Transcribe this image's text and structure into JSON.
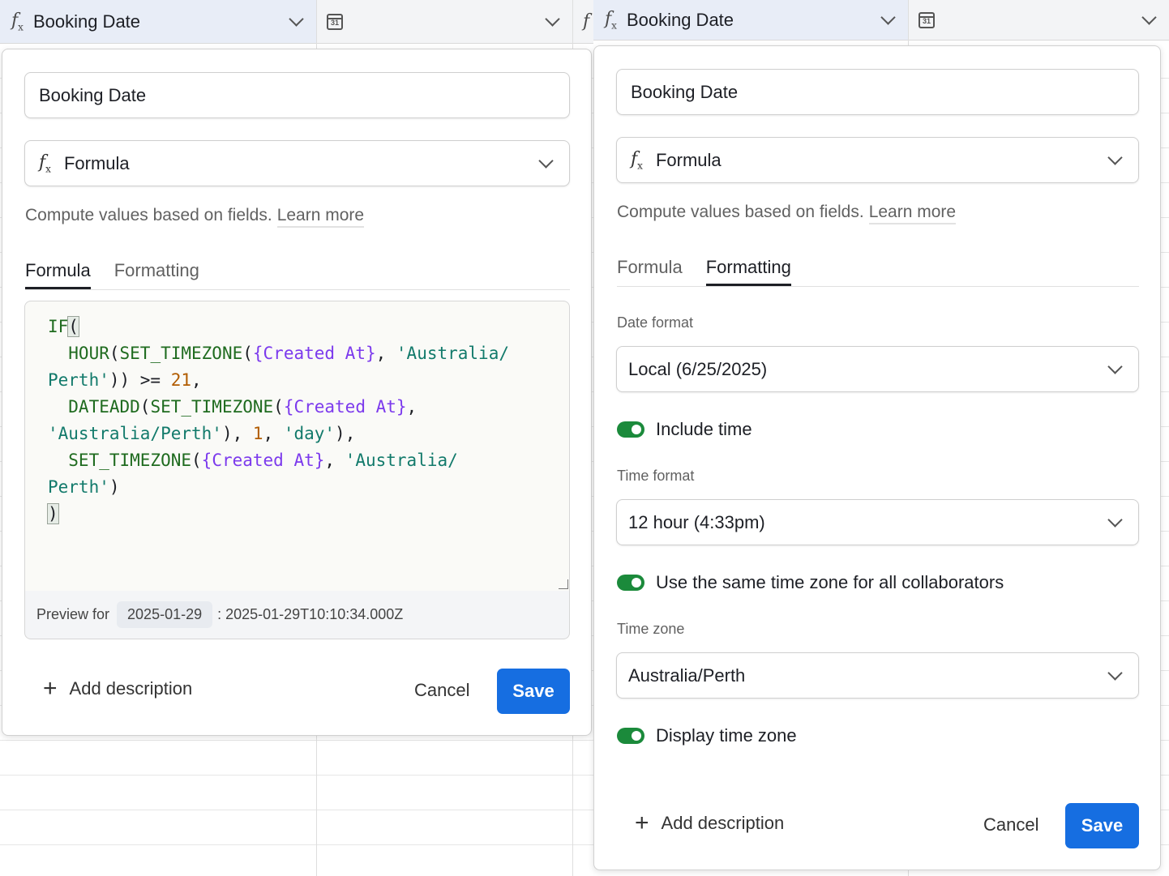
{
  "header": {
    "left_field_title": "Booking Date",
    "right_field_title": "Booking Date",
    "fx_glyph": "f",
    "fx_sub": "x",
    "calendar_glyph": "31"
  },
  "left_panel": {
    "name_value": "Booking Date",
    "type_label": "Formula",
    "hint": "Compute values based on fields.",
    "learn_more": "Learn more",
    "tabs": [
      "Formula",
      "Formatting"
    ],
    "active_tab": "Formula",
    "code_lines": [
      [
        {
          "t": "IF",
          "c": "k"
        },
        {
          "t": "(",
          "c": "hl"
        }
      ],
      [
        {
          "t": "  HOUR",
          "c": "k"
        },
        {
          "t": "(",
          "c": ""
        },
        {
          "t": "SET_TIMEZONE",
          "c": "k"
        },
        {
          "t": "(",
          "c": ""
        },
        {
          "t": "{Created At}",
          "c": "f"
        },
        {
          "t": ", ",
          "c": ""
        },
        {
          "t": "'Australia/",
          "c": "s"
        }
      ],
      [
        {
          "t": "Perth'",
          "c": "s"
        },
        {
          "t": ")) >= ",
          "c": ""
        },
        {
          "t": "21",
          "c": "n"
        },
        {
          "t": ",",
          "c": ""
        }
      ],
      [
        {
          "t": "  DATEADD",
          "c": "k"
        },
        {
          "t": "(",
          "c": ""
        },
        {
          "t": "SET_TIMEZONE",
          "c": "k"
        },
        {
          "t": "(",
          "c": ""
        },
        {
          "t": "{Created At}",
          "c": "f"
        },
        {
          "t": ",",
          "c": ""
        }
      ],
      [
        {
          "t": "'Australia/Perth'",
          "c": "s"
        },
        {
          "t": "), ",
          "c": ""
        },
        {
          "t": "1",
          "c": "n"
        },
        {
          "t": ", ",
          "c": ""
        },
        {
          "t": "'day'",
          "c": "s"
        },
        {
          "t": "),",
          "c": ""
        }
      ],
      [
        {
          "t": "  SET_TIMEZONE",
          "c": "k"
        },
        {
          "t": "(",
          "c": ""
        },
        {
          "t": "{Created At}",
          "c": "f"
        },
        {
          "t": ", ",
          "c": ""
        },
        {
          "t": "'Australia/",
          "c": "s"
        }
      ],
      [
        {
          "t": "Perth'",
          "c": "s"
        },
        {
          "t": ")",
          "c": ""
        }
      ],
      [
        {
          "t": ")",
          "c": "hl"
        }
      ]
    ],
    "preview_label": "Preview for",
    "preview_chip": "2025-01-29",
    "preview_value": ": 2025-01-29T10:10:34.000Z",
    "add_description": "Add description",
    "cancel": "Cancel",
    "save": "Save"
  },
  "right_panel": {
    "name_value": "Booking Date",
    "type_label": "Formula",
    "hint": "Compute values based on fields.",
    "learn_more": "Learn more",
    "tabs": [
      "Formula",
      "Formatting"
    ],
    "active_tab": "Formatting",
    "date_format_label": "Date format",
    "date_format_value": "Local (6/25/2025)",
    "include_time_label": "Include time",
    "include_time_on": true,
    "time_format_label": "Time format",
    "time_format_value": "12 hour (4:33pm)",
    "same_tz_label": "Use the same time zone for all collaborators",
    "same_tz_on": true,
    "time_zone_label": "Time zone",
    "time_zone_value": "Australia/Perth",
    "display_tz_label": "Display time zone",
    "display_tz_on": true,
    "add_description": "Add description",
    "cancel": "Cancel",
    "save": "Save"
  },
  "colors": {
    "save_blue": "#166ee1",
    "toggle_green": "#1b8a3b",
    "keyword_green": "#1f6b1f",
    "field_purple": "#7c3aed",
    "string_teal": "#127a6b",
    "number_orange": "#b15c00"
  }
}
